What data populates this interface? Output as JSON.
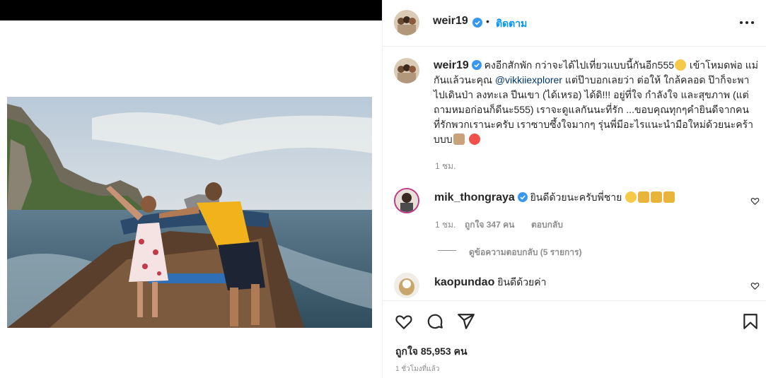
{
  "header": {
    "username": "weir19",
    "dot": "•",
    "follow_label": "ติดตาม"
  },
  "caption": {
    "username": "weir19",
    "text_1": "คงอีกสักพัก กว่าจะได้ไปเที่ยวแบบนี้กันอีก555",
    "text_2": " เข้าโหมดพ่อ แม่ กันแล้วนะคุณ ",
    "mention": "@vikkiiexplorer",
    "text_3": " แต่ป๊าบอกเลยว่า ต่อให้ ใกล้คลอด ป๊าก็จะพาไปเดินป่า ลงทะเล ปีนเขา (ได้เหรอ) ได้ดิ!!! อยู่ที่ใจ กำลังใจ และสุขภาพ (แต่ถามหมอก่อนก็ดีนะ555) เราจะดูแลกันนะที่รัก ...ขอบคุณทุกๆคำยินดีจากคนที่รักพวกเรานะครับ เราซาบซึ้งใจมากๆ รุ่นพี่มีอะไรแนะนำมือใหม่ด้วยนะคร้าบบบ",
    "time": "1 ชม."
  },
  "comment1": {
    "username": "mik_thongraya",
    "text": "ยินดีด้วยนะครับพี่ชาย",
    "time": "1 ชม.",
    "likes": "ถูกใจ 347 คน",
    "reply": "ตอบกลับ",
    "view_replies": "ดูข้อความตอบกลับ (5 รายการ)"
  },
  "comment2": {
    "username": "kaopundao",
    "text": "ยินดีด้วยค่า"
  },
  "footer": {
    "likes": "ถูกใจ 85,953 คน",
    "time_ago": "1 ชั่วโมงที่แล้ว"
  },
  "icons": {
    "verified": "verified-badge-icon",
    "more": "more-options-icon",
    "like": "heart-icon",
    "comment": "comment-icon",
    "share": "share-icon",
    "save": "bookmark-icon"
  },
  "colors": {
    "accent": "#0095f6",
    "verified": "#3897f0",
    "mention": "#00376b",
    "meta": "#8e8e8e"
  }
}
